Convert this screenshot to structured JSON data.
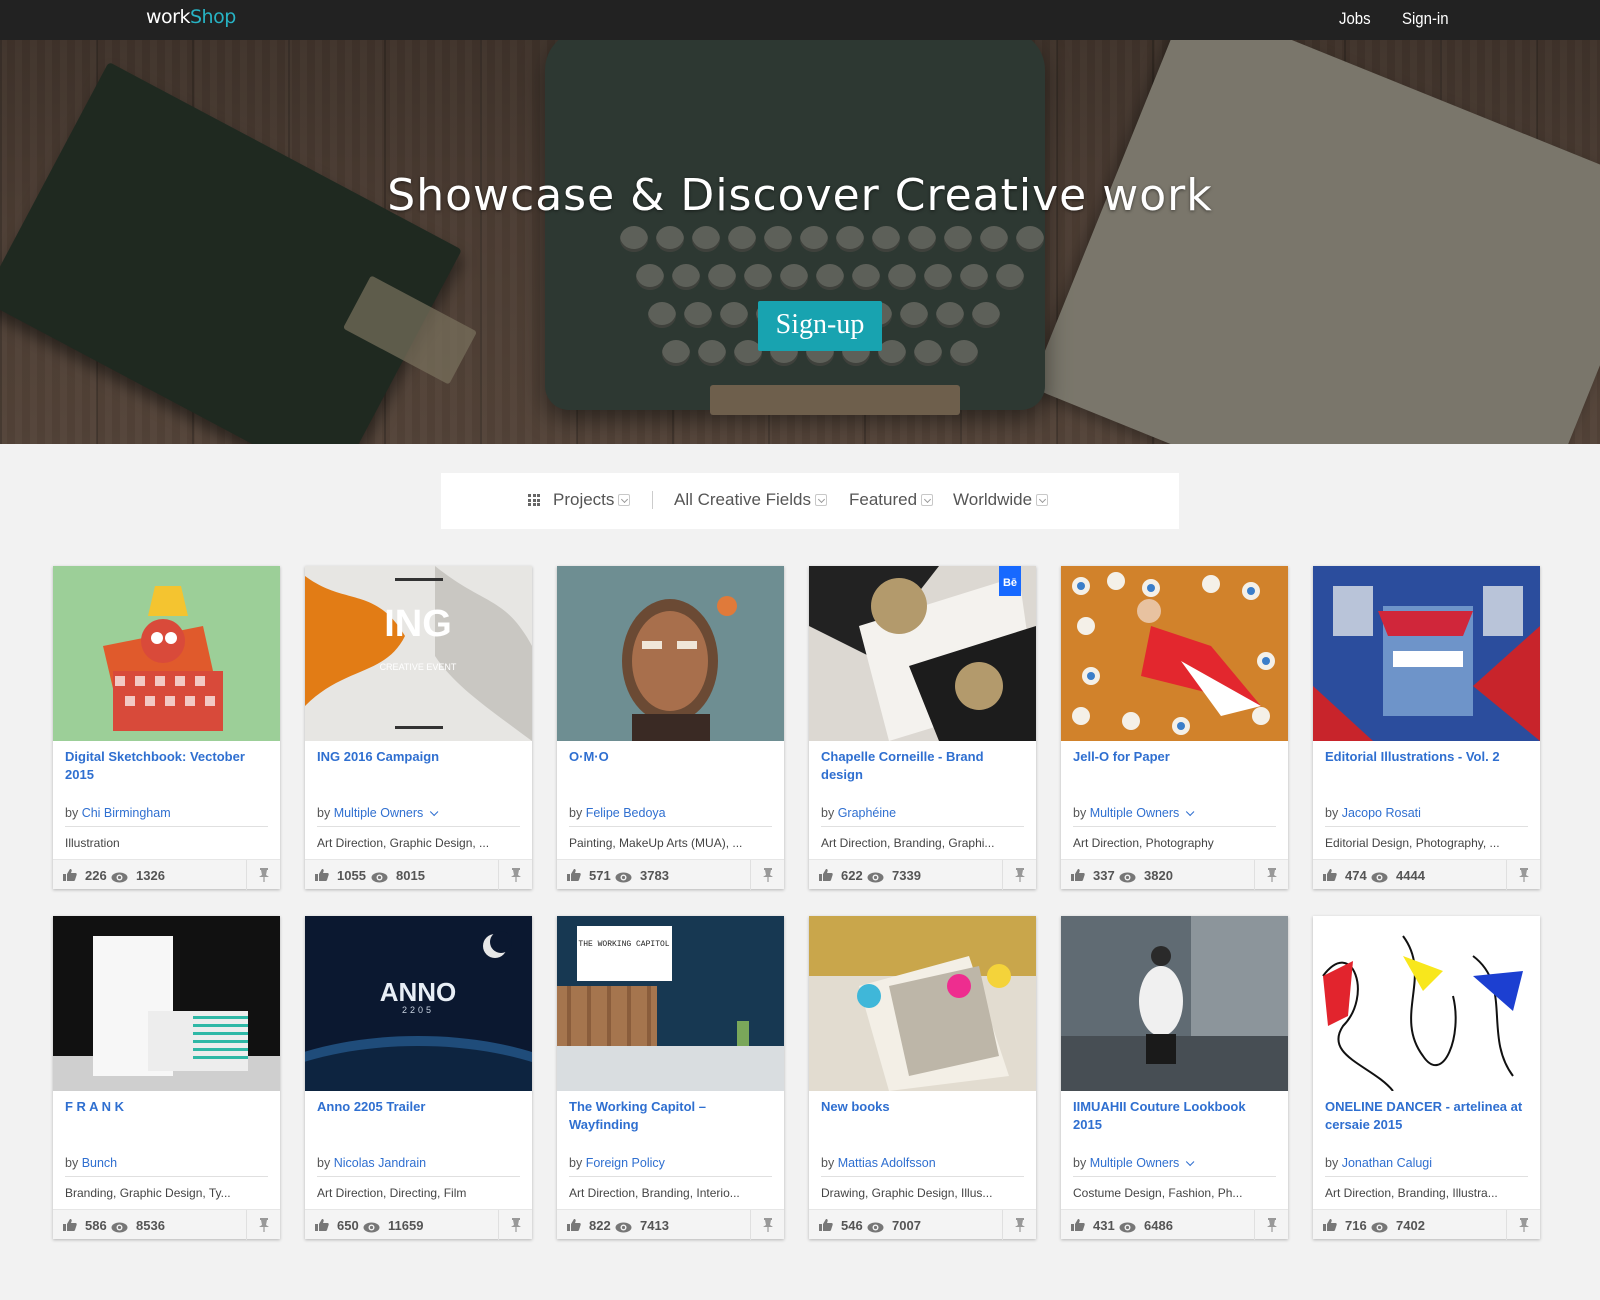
{
  "brand": {
    "logo_part1": "work",
    "logo_part2": "Shop"
  },
  "nav": {
    "jobs": "Jobs",
    "signin": "Sign-in"
  },
  "hero": {
    "title": "Showcase & Discover Creative work",
    "signup": "Sign-up"
  },
  "filters": {
    "projects": "Projects",
    "fields": "All Creative Fields",
    "featured": "Featured",
    "worldwide": "Worldwide"
  },
  "cards": [
    {
      "title": "Digital Sketchbook: Vectober 2015",
      "by": "by",
      "owner": "Chi Birmingham",
      "owner_dropdown": false,
      "fields": "Illustration",
      "likes": "226",
      "views": "1326"
    },
    {
      "title": "ING 2016 Campaign",
      "by": "by",
      "owner": "Multiple Owners",
      "owner_dropdown": true,
      "fields": "Art Direction, Graphic Design, ...",
      "likes": "1055",
      "views": "8015",
      "art_text": "ING",
      "art_sub": "CREATIVE EVENT"
    },
    {
      "title": "O·M·O",
      "by": "by",
      "owner": "Felipe Bedoya",
      "owner_dropdown": false,
      "fields": "Painting, MakeUp Arts (MUA), ...",
      "likes": "571",
      "views": "3783"
    },
    {
      "title": "Chapelle Corneille - Brand design",
      "by": "by",
      "owner": "Graphéine",
      "owner_dropdown": false,
      "fields": "Art Direction, Branding, Graphi...",
      "likes": "622",
      "views": "7339",
      "badge": "Bē"
    },
    {
      "title": "Jell-O for Paper",
      "by": "by",
      "owner": "Multiple Owners",
      "owner_dropdown": true,
      "fields": "Art Direction, Photography",
      "likes": "337",
      "views": "3820"
    },
    {
      "title": "Editorial Illustrations - Vol. 2",
      "by": "by",
      "owner": "Jacopo Rosati",
      "owner_dropdown": false,
      "fields": "Editorial Design, Photography, ...",
      "likes": "474",
      "views": "4444"
    },
    {
      "title": "F R A N K",
      "by": "by",
      "owner": "Bunch",
      "owner_dropdown": false,
      "fields": "Branding, Graphic Design, Ty...",
      "likes": "586",
      "views": "8536"
    },
    {
      "title": "Anno 2205 Trailer",
      "by": "by",
      "owner": "Nicolas Jandrain",
      "owner_dropdown": false,
      "fields": "Art Direction, Directing, Film",
      "likes": "650",
      "views": "11659",
      "art_text": "ANNO",
      "art_sub": "2205"
    },
    {
      "title": "The Working Capitol – Wayfinding",
      "by": "by",
      "owner": "Foreign Policy",
      "owner_dropdown": false,
      "fields": "Art Direction, Branding, Interio...",
      "likes": "822",
      "views": "7413",
      "art_text": "THE WORKING CAPITOL"
    },
    {
      "title": "New books",
      "by": "by",
      "owner": "Mattias Adolfsson",
      "owner_dropdown": false,
      "fields": "Drawing, Graphic Design, Illus...",
      "likes": "546",
      "views": "7007"
    },
    {
      "title": "IIMUAHII Couture Lookbook 2015",
      "by": "by",
      "owner": "Multiple Owners",
      "owner_dropdown": true,
      "fields": "Costume Design, Fashion, Ph...",
      "likes": "431",
      "views": "6486"
    },
    {
      "title": "ONELINE DANCER - artelinea at cersaie 2015",
      "by": "by",
      "owner": "Jonathan Calugi",
      "owner_dropdown": false,
      "fields": "Art Direction, Branding, Illustra...",
      "likes": "716",
      "views": "7402"
    }
  ],
  "colors": {
    "accent": "#18a3b0",
    "link": "#2f6fd0",
    "nav_bg": "#222222",
    "page_bg": "#f2f2f2"
  },
  "icons": {
    "like": "thumbs-up-icon",
    "views": "eye-icon",
    "appreciate": "pin-icon",
    "projects": "grid-icon"
  }
}
